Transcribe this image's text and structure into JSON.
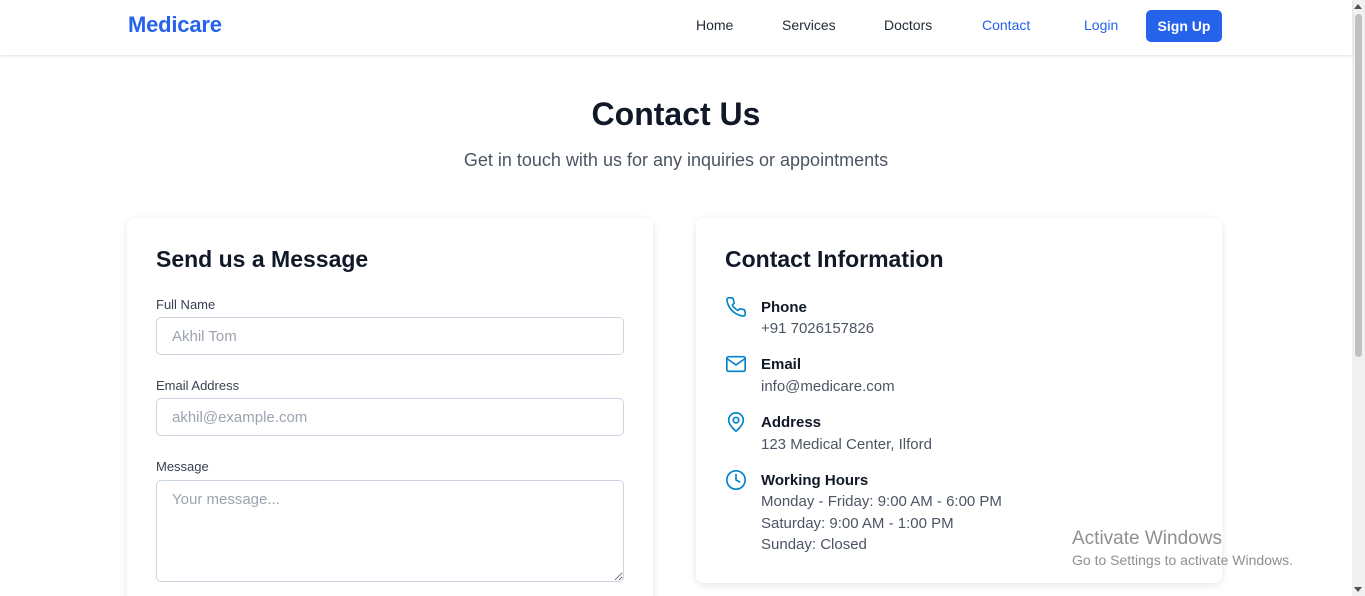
{
  "navbar": {
    "brand": "Medicare",
    "links": [
      {
        "label": "Home",
        "active": false
      },
      {
        "label": "Services",
        "active": false
      },
      {
        "label": "Doctors",
        "active": false
      },
      {
        "label": "Contact",
        "active": true
      }
    ],
    "login_label": "Login",
    "signup_label": "Sign Up"
  },
  "header": {
    "title": "Contact Us",
    "subtitle": "Get in touch with us for any inquiries or appointments"
  },
  "form": {
    "title": "Send us a Message",
    "name_label": "Full Name",
    "name_placeholder": "Akhil Tom",
    "name_value": "",
    "email_label": "Email Address",
    "email_placeholder": "akhil@example.com",
    "email_value": "",
    "message_label": "Message",
    "message_placeholder": "Your message...",
    "message_value": ""
  },
  "contact_info": {
    "title": "Contact Information",
    "items": [
      {
        "icon": "phone-icon",
        "label": "Phone",
        "lines": [
          "+91 7026157826"
        ]
      },
      {
        "icon": "mail-icon",
        "label": "Email",
        "lines": [
          "info@medicare.com"
        ]
      },
      {
        "icon": "map-pin-icon",
        "label": "Address",
        "lines": [
          "123 Medical Center, Ilford"
        ]
      },
      {
        "icon": "clock-icon",
        "label": "Working Hours",
        "lines": [
          "Monday - Friday: 9:00 AM - 6:00 PM",
          "Saturday: 9:00 AM - 1:00 PM",
          "Sunday: Closed"
        ]
      }
    ]
  },
  "watermark": {
    "title": "Activate Windows",
    "subtitle": "Go to Settings to activate Windows."
  },
  "colors": {
    "accent": "#2563eb",
    "icon": "#0284c7",
    "text": "#111827",
    "muted": "#4b5563"
  }
}
